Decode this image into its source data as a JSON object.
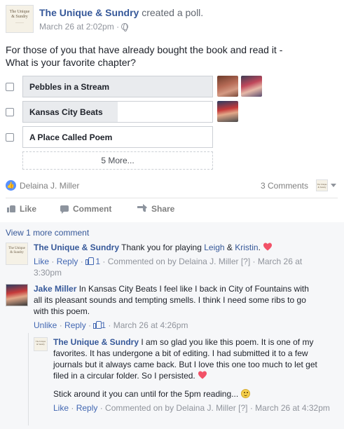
{
  "post": {
    "page_name": "The Unique & Sundry",
    "action_text": " created a poll.",
    "timestamp": "March 26 at 2:02pm",
    "separator": " · ",
    "avatar_text_top": "The Unique",
    "avatar_text_bottom": "& Sundry",
    "question_line1": "For those of you that have already bought the book and read it -",
    "question_line2": "What is your favorite chapter?"
  },
  "poll": {
    "options": [
      {
        "label": "Pebbles in a Stream",
        "vote_share": 1.0,
        "voter_count": 2
      },
      {
        "label": "Kansas City Beats",
        "vote_share": 0.5,
        "voter_count": 1
      },
      {
        "label": "A Place Called Poem",
        "vote_share": 0.0,
        "voter_count": 0
      }
    ],
    "more_label": "5 More..."
  },
  "reactions": {
    "reactor_name": "Delaina J. Miller",
    "comment_count": "3 Comments",
    "like_icon": "thumbs-up-icon"
  },
  "actions": {
    "like": "Like",
    "comment": "Comment",
    "share": "Share"
  },
  "comments_section": {
    "view_more": "View 1 more comment",
    "comments": [
      {
        "author": "The Unique & Sundry",
        "text_before": "Thank you for playing ",
        "mention1": "Leigh",
        "amp": " & ",
        "mention2": "Kristin",
        "text_after": ".",
        "like": "Like",
        "reply": "Reply",
        "like_count": "1",
        "commented_on_by": "Commented on by Delaina J. Miller",
        "help": "[?]",
        "time": "March 26 at 3:30pm",
        "dot": " · "
      },
      {
        "author": "Jake Miller",
        "text": "In Kansas City Beats I feel like I back in City of Fountains with all its pleasant sounds and tempting smells. I think I need some ribs to go with this poem.",
        "unlike": "Unlike",
        "reply": "Reply",
        "like_count": "1",
        "time": "March 26 at 4:26pm",
        "dot": " · "
      },
      {
        "author": "The Unique & Sundry",
        "text": "I am so glad you like this poem. It is one of my favorites. It has undergone a bit of editing. I had submitted it to a few journals but it always came back. But I love this one too much to let get filed in a circular folder. So I persisted.",
        "text2": "Stick around it you can until for the 5pm reading...",
        "like": "Like",
        "reply": "Reply",
        "commented_on_by": "Commented on by Delaina J. Miller",
        "help": "[?]",
        "time": "March 26 at 4:32pm",
        "dot": " · "
      }
    ]
  },
  "colors": {
    "link": "#365899",
    "accent": "#4267b2",
    "heart": "#f25268",
    "poll_fill": "#e9ebee"
  }
}
